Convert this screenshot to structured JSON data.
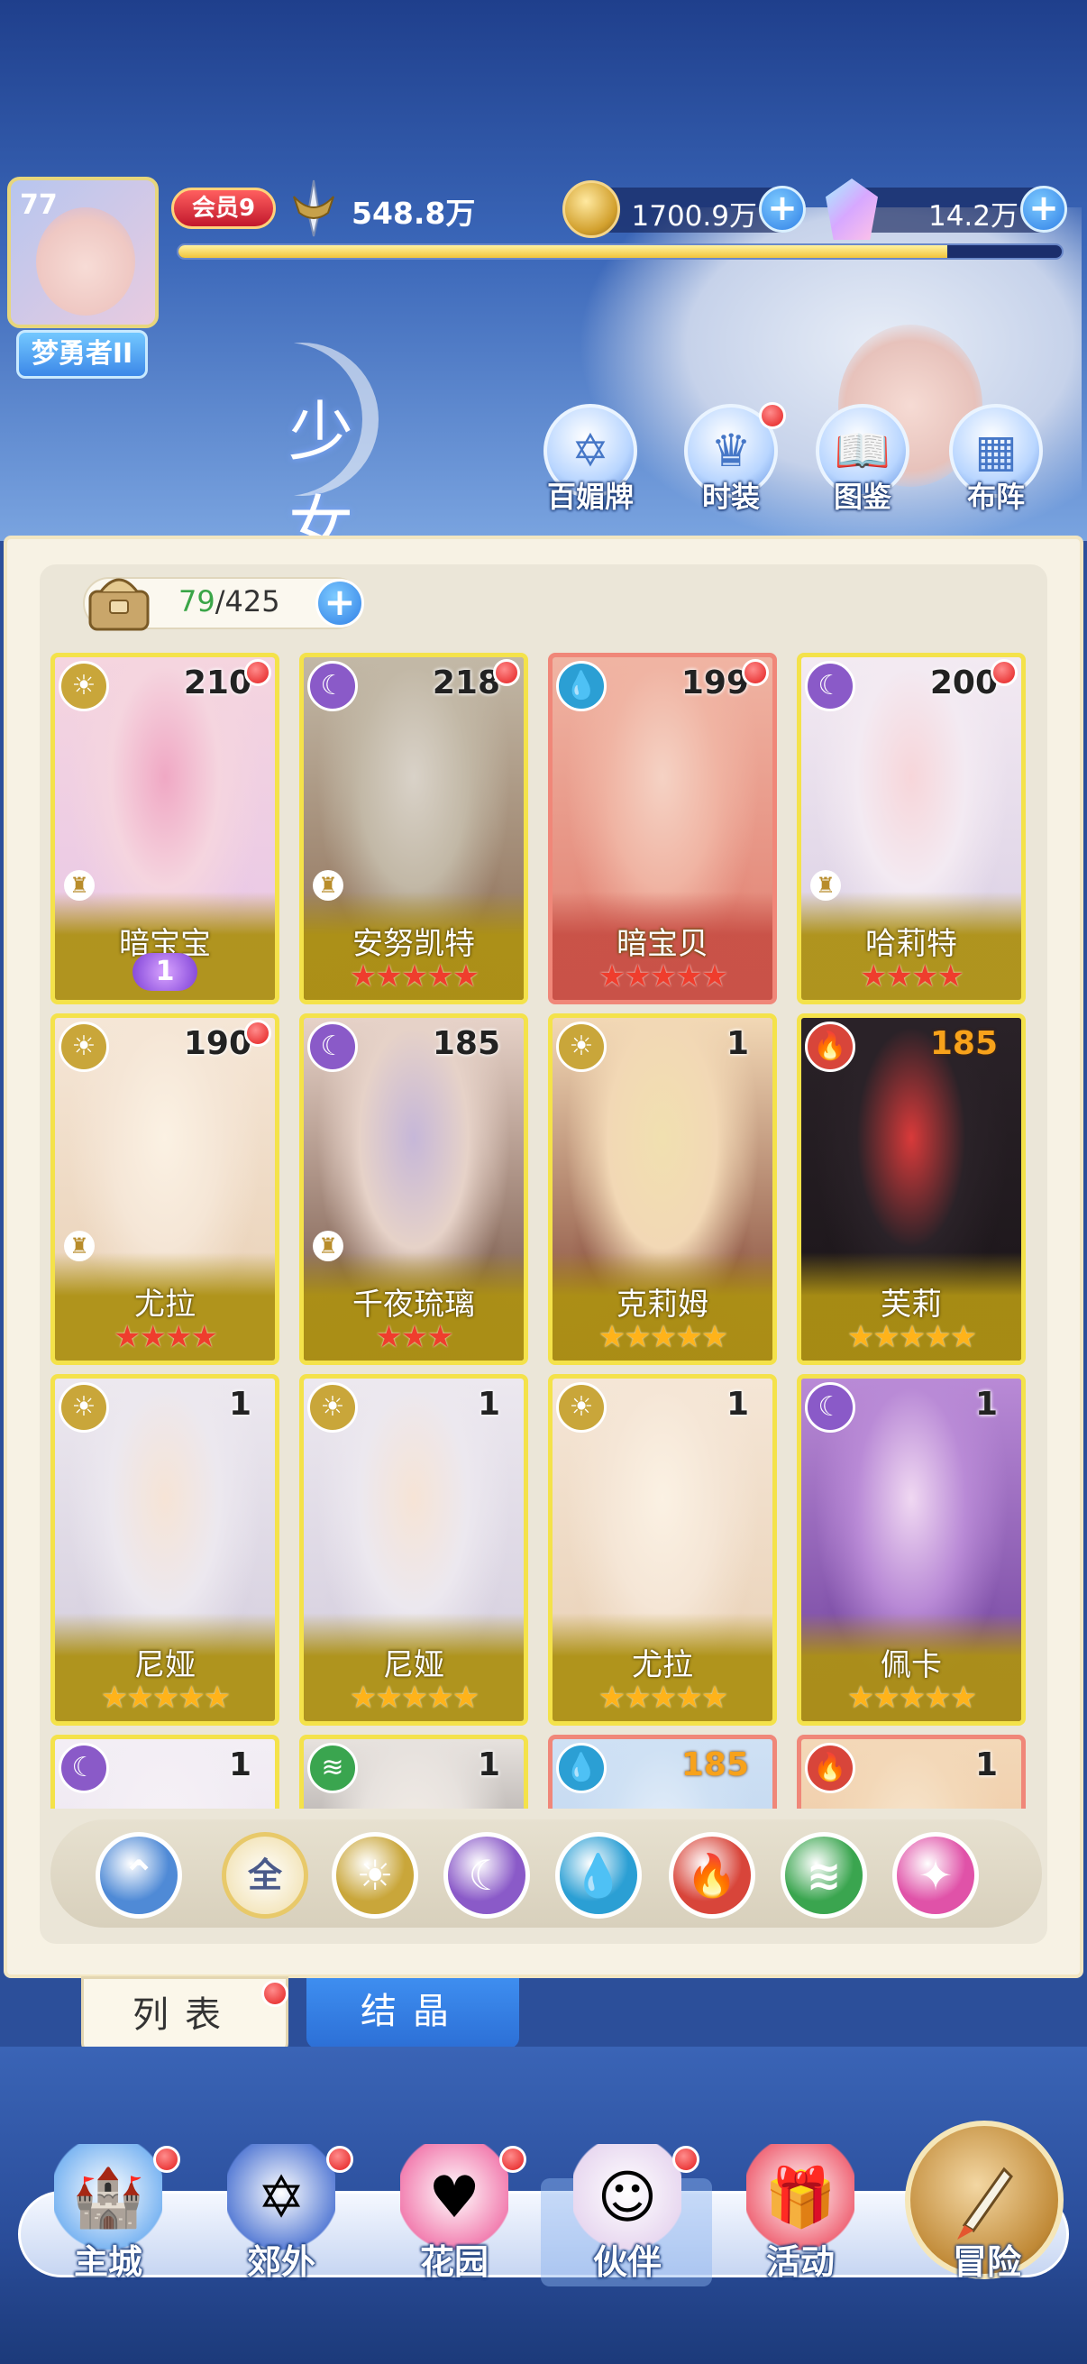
{
  "player": {
    "level": "77",
    "title": "梦勇者II",
    "vip": "会员9",
    "power": "548.8万",
    "gold": "1700.9万",
    "gems": "14.2万",
    "exp_progress": 0.87
  },
  "page": {
    "title": "少女",
    "top_buttons": [
      {
        "label": "百媚牌",
        "icon": "card-star-icon",
        "dot": false
      },
      {
        "label": "时装",
        "icon": "dress-icon",
        "dot": true
      },
      {
        "label": "图鉴",
        "icon": "book-icon",
        "dot": false
      },
      {
        "label": "布阵",
        "icon": "grid-icon",
        "dot": false
      }
    ]
  },
  "bag": {
    "current": "79",
    "max": "/425"
  },
  "cards": [
    {
      "name": "暗宝宝",
      "level": "210",
      "element": "sun",
      "stars": 0,
      "star_color": "red",
      "awaken": "1",
      "rook": true,
      "dot": true,
      "frame": "gold",
      "art": [
        "#f5d5df",
        "#e7c6e8",
        "#f0a8c4"
      ]
    },
    {
      "name": "安努凯特",
      "level": "218",
      "element": "moon",
      "stars": 5,
      "star_color": "red",
      "rook": true,
      "dot": true,
      "frame": "gold",
      "art": [
        "#c2b8a6",
        "#8b6a52",
        "#d9d2c8"
      ]
    },
    {
      "name": "暗宝贝",
      "level": "199",
      "element": "water",
      "stars": 5,
      "star_color": "red",
      "rook": false,
      "dot": true,
      "frame": "red",
      "art": [
        "#f0b4a3",
        "#e07d6e",
        "#f5d2c4"
      ]
    },
    {
      "name": "哈莉特",
      "level": "200",
      "element": "moon",
      "stars": 4,
      "star_color": "red",
      "rook": true,
      "dot": true,
      "frame": "gold",
      "art": [
        "#f3eaf2",
        "#d8cde3",
        "#f7d6da"
      ]
    },
    {
      "name": "尤拉",
      "level": "190",
      "element": "sun",
      "stars": 4,
      "star_color": "red",
      "rook": true,
      "dot": true,
      "frame": "gold",
      "art": [
        "#f5e6d6",
        "#e8cfb4",
        "#fbf1e3"
      ]
    },
    {
      "name": "千夜琉璃",
      "level": "185",
      "element": "moon",
      "stars": 3,
      "star_color": "red",
      "rook": true,
      "dot": false,
      "frame": "gold",
      "art": [
        "#e6d2c8",
        "#6b4a3a",
        "#c6b7d8"
      ]
    },
    {
      "name": "克莉姆",
      "level": "1",
      "element": "sun",
      "stars": 5,
      "star_color": "gold",
      "rook": false,
      "dot": false,
      "frame": "gold",
      "art": [
        "#f2d8b5",
        "#7a3c2e",
        "#f1e0b0"
      ]
    },
    {
      "name": "芙莉",
      "level": "185",
      "level_color": "orange",
      "element": "fire",
      "stars": 5,
      "star_color": "gold",
      "rook": false,
      "dot": false,
      "frame": "gold",
      "art": [
        "#2a2228",
        "#1a1418",
        "#d93a3a"
      ]
    },
    {
      "name": "尼娅",
      "level": "1",
      "element": "sun",
      "stars": 5,
      "star_color": "gold",
      "rook": false,
      "dot": false,
      "frame": "gold",
      "art": [
        "#ece8ef",
        "#d2cbdc",
        "#f6e4d6"
      ]
    },
    {
      "name": "尼娅",
      "level": "1",
      "element": "sun",
      "stars": 5,
      "star_color": "gold",
      "rook": false,
      "dot": false,
      "frame": "gold",
      "art": [
        "#ece8ef",
        "#d2cbdc",
        "#f6e4d6"
      ]
    },
    {
      "name": "尤拉",
      "level": "1",
      "element": "sun",
      "stars": 5,
      "star_color": "gold",
      "rook": false,
      "dot": false,
      "frame": "gold",
      "art": [
        "#f5e6d6",
        "#e8cfb4",
        "#fbf1e3"
      ]
    },
    {
      "name": "佩卡",
      "level": "1",
      "element": "moon",
      "stars": 5,
      "star_color": "gold",
      "rook": false,
      "dot": false,
      "frame": "gold",
      "art": [
        "#b98ad6",
        "#6d3f9a",
        "#f0d8f2"
      ]
    },
    {
      "name": "",
      "level": "1",
      "element": "moon",
      "stars": 0,
      "star_color": "gold",
      "rook": false,
      "dot": false,
      "frame": "gold",
      "art": [
        "#f3eef5",
        "#e6dcea",
        "#f7f2f6"
      ]
    },
    {
      "name": "",
      "level": "1",
      "element": "wind",
      "stars": 0,
      "star_color": "gold",
      "rook": false,
      "dot": false,
      "frame": "gold",
      "art": [
        "#e7e2de",
        "#3a3434",
        "#f4eee8"
      ]
    },
    {
      "name": "",
      "level": "185",
      "level_color": "orange",
      "element": "water",
      "stars": 0,
      "star_color": "gold",
      "rook": false,
      "dot": false,
      "frame": "red",
      "art": [
        "#cfe1f4",
        "#a9c4ea",
        "#e9f1fb"
      ]
    },
    {
      "name": "",
      "level": "1",
      "element": "fire",
      "stars": 0,
      "star_color": "gold",
      "rook": false,
      "dot": false,
      "frame": "red",
      "art": [
        "#f3d8b8",
        "#eab48a",
        "#f8e8d2"
      ]
    }
  ],
  "filters": [
    {
      "id": "collapse",
      "label": "",
      "icon": "collapse-arrow-icon"
    },
    {
      "id": "all",
      "label": "全",
      "icon": "all-icon"
    },
    {
      "id": "sun",
      "label": "",
      "icon": "sun-element-icon"
    },
    {
      "id": "moon",
      "label": "",
      "icon": "moon-element-icon"
    },
    {
      "id": "water",
      "label": "",
      "icon": "water-element-icon"
    },
    {
      "id": "fire",
      "label": "",
      "icon": "fire-element-icon"
    },
    {
      "id": "wind",
      "label": "",
      "icon": "wind-element-icon"
    },
    {
      "id": "star",
      "label": "",
      "icon": "orbit-element-icon"
    }
  ],
  "tabs": {
    "list": "列表",
    "crystal": "结晶"
  },
  "nav": [
    {
      "label": "主城",
      "icon": "castle-icon",
      "dot": true
    },
    {
      "label": "郊外",
      "icon": "portal-icon",
      "dot": true
    },
    {
      "label": "花园",
      "icon": "heart-icon",
      "dot": true
    },
    {
      "label": "伙伴",
      "icon": "partner-icon",
      "dot": true
    },
    {
      "label": "活动",
      "icon": "gift-icon",
      "dot": false
    }
  ],
  "adventure": {
    "label": "冒险",
    "icon": "compass-icon"
  },
  "colors": {
    "sun": "#c9a63a",
    "moon": "#8a5ac8",
    "water": "#2b9fd4",
    "fire": "#d8453a",
    "wind": "#3aa54f",
    "star": "#e052a8",
    "all": "#f4e7c0",
    "collapse": "#4f8ad6"
  }
}
